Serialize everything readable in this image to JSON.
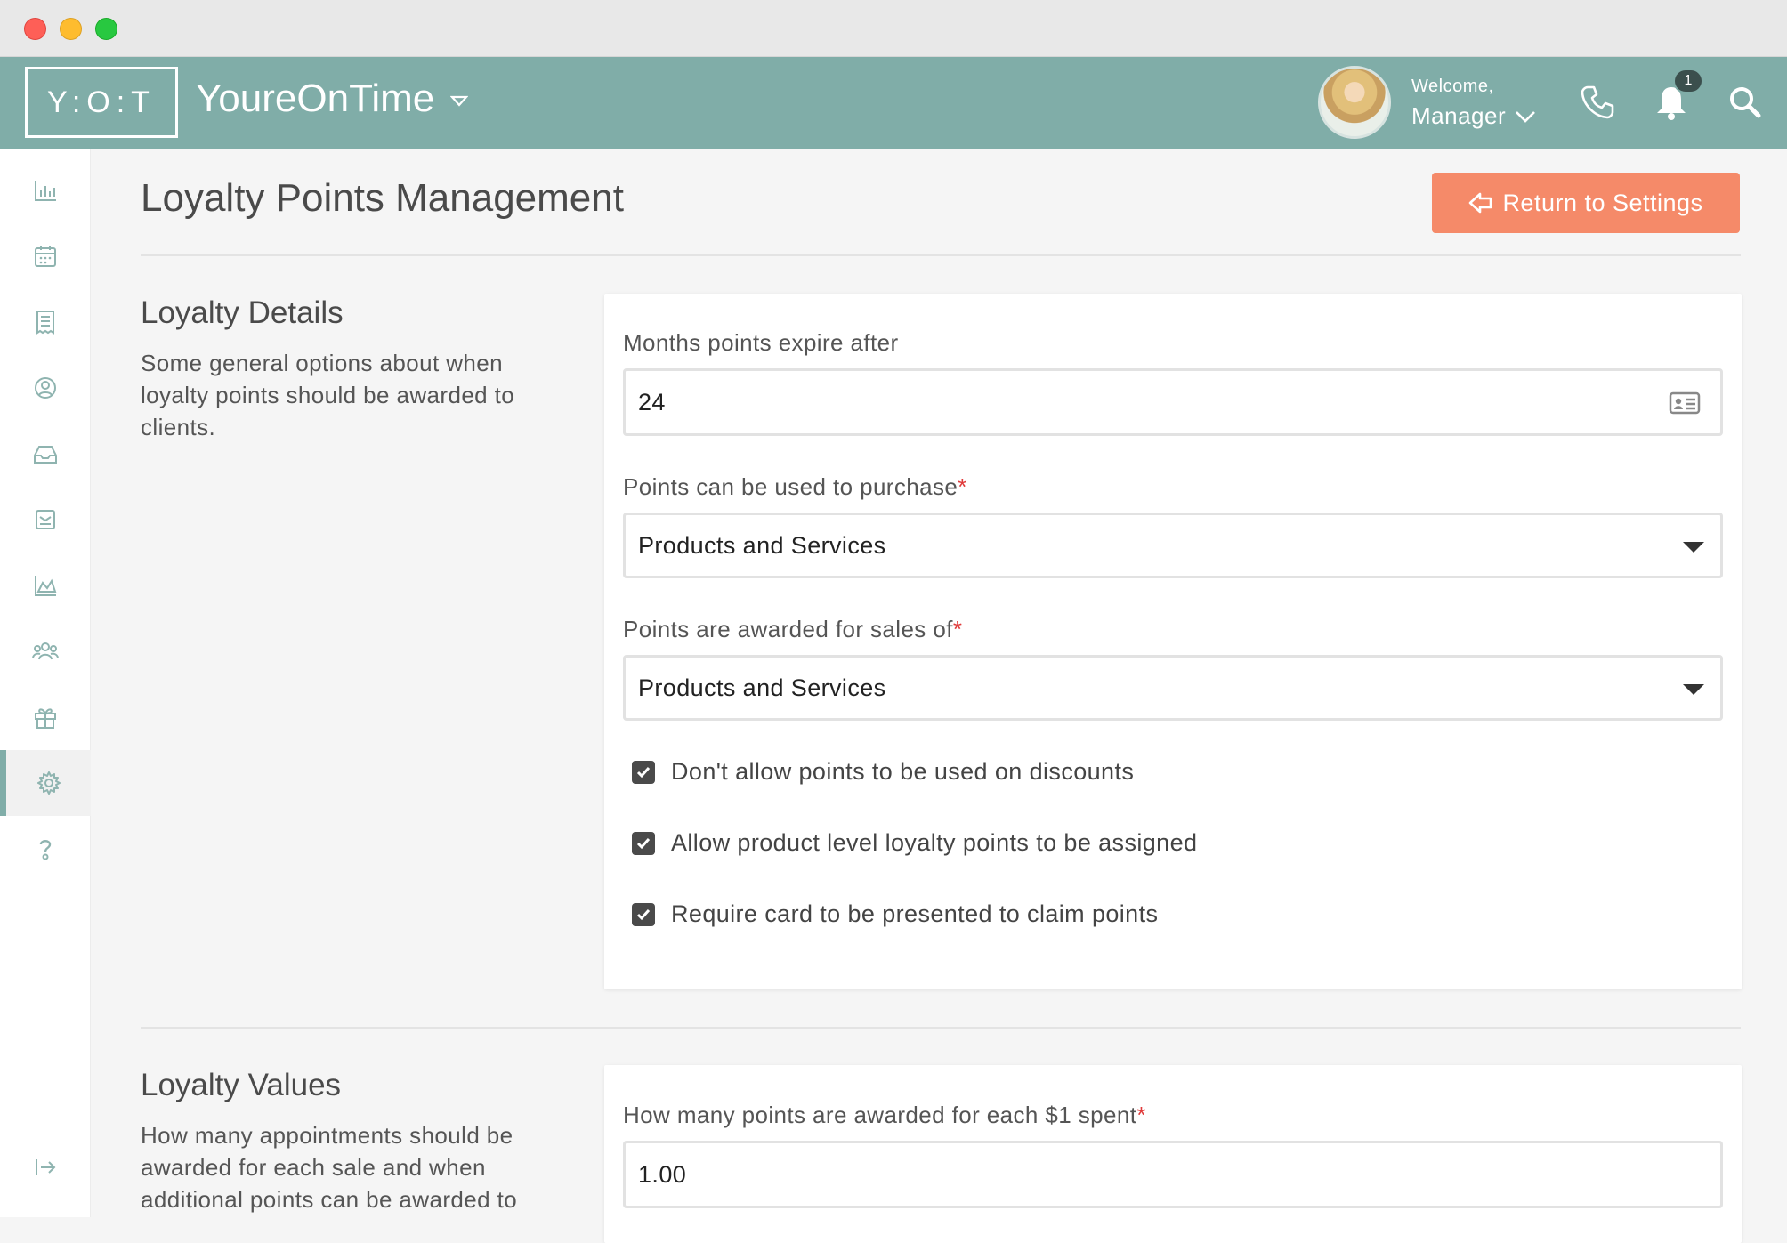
{
  "header": {
    "logo_text": "Y:O:T",
    "brand": "YoureOnTime",
    "welcome_label": "Welcome,",
    "user_name": "Manager",
    "notification_count": "1"
  },
  "sidebar": {
    "items": [
      {
        "icon": "bar-chart-icon"
      },
      {
        "icon": "calendar-icon"
      },
      {
        "icon": "receipt-icon"
      },
      {
        "icon": "user-circle-icon"
      },
      {
        "icon": "inbox-icon"
      },
      {
        "icon": "mail-icon"
      },
      {
        "icon": "area-chart-icon"
      },
      {
        "icon": "users-icon"
      },
      {
        "icon": "gift-icon"
      },
      {
        "icon": "settings-icon",
        "active": true
      },
      {
        "icon": "help-icon"
      },
      {
        "icon": "logout-icon"
      }
    ]
  },
  "page": {
    "title": "Loyalty Points Management",
    "return_button": "Return to Settings"
  },
  "details": {
    "title": "Loyalty Details",
    "description": "Some general options about when loyalty points should be awarded to clients.",
    "expire_label": "Months points expire after",
    "expire_value": "24",
    "purchase_label": "Points can be used to purchase",
    "purchase_value": "Products and Services",
    "awarded_label": "Points are awarded for sales of",
    "awarded_value": "Products and Services",
    "checkboxes": [
      {
        "label": "Don't allow points to be used on discounts",
        "checked": true
      },
      {
        "label": "Allow product level loyalty points to be assigned",
        "checked": true
      },
      {
        "label": "Require card to be presented to claim points",
        "checked": true
      }
    ]
  },
  "values": {
    "title": "Loyalty Values",
    "description": "How many appointments should be awarded for each sale and when additional points can be awarded to",
    "points_label": "How many points are awarded for each $1 spent",
    "points_value": "1.00"
  },
  "colors": {
    "header": "#80ada8",
    "accent_button": "#f58a69",
    "required": "#e03a3a"
  }
}
